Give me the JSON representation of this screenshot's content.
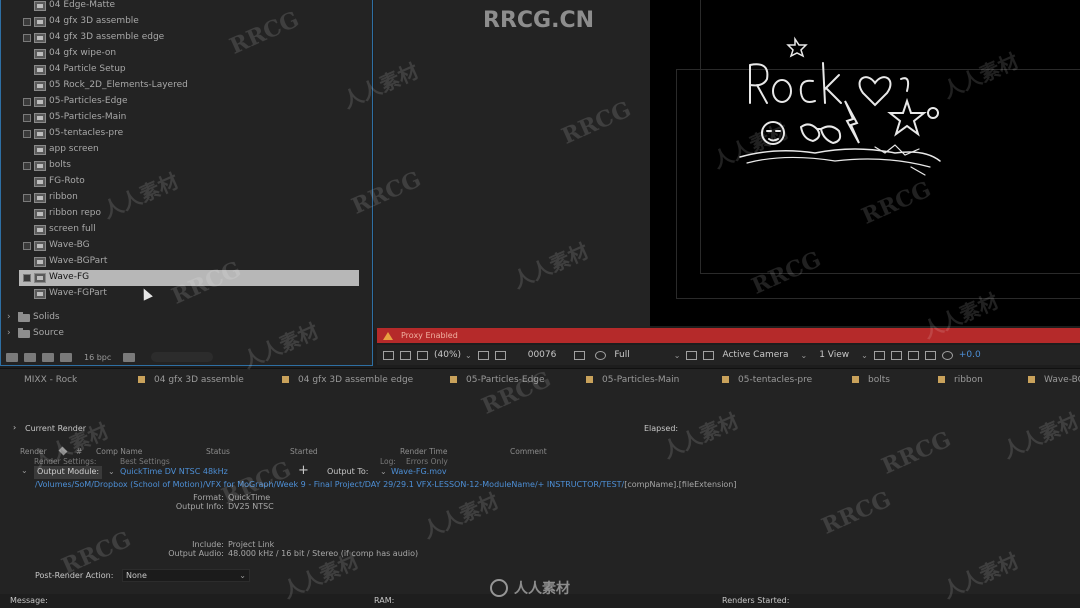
{
  "project": {
    "items": [
      {
        "label": "04 Edge-Matte",
        "checkbox": false
      },
      {
        "label": "04 gfx 3D assemble",
        "checkbox": true
      },
      {
        "label": "04 gfx 3D assemble edge",
        "checkbox": true
      },
      {
        "label": "04 gfx wipe-on",
        "checkbox": false
      },
      {
        "label": "04 Particle Setup",
        "checkbox": false
      },
      {
        "label": "05 Rock_2D_Elements-Layered",
        "checkbox": false
      },
      {
        "label": "05-Particles-Edge",
        "checkbox": true
      },
      {
        "label": "05-Particles-Main",
        "checkbox": true
      },
      {
        "label": "05-tentacles-pre",
        "checkbox": true
      },
      {
        "label": "app screen",
        "checkbox": false
      },
      {
        "label": "bolts",
        "checkbox": true
      },
      {
        "label": "FG-Roto",
        "checkbox": false
      },
      {
        "label": "ribbon",
        "checkbox": true
      },
      {
        "label": "ribbon repo",
        "checkbox": false
      },
      {
        "label": "screen full",
        "checkbox": false
      },
      {
        "label": "Wave-BG",
        "checkbox": true
      },
      {
        "label": "Wave-BGPart",
        "checkbox": false
      },
      {
        "label": "Wave-FG",
        "checkbox": true,
        "selected": true
      },
      {
        "label": "Wave-FGPart",
        "checkbox": false
      }
    ],
    "folders": [
      "Solids",
      "Source"
    ],
    "bpc": "16 bpc"
  },
  "viewer": {
    "proxy_text": "Proxy Enabled",
    "zoom": "(40%)",
    "timecode": "00076",
    "resolution": "Full",
    "camera": "Active Camera",
    "views": "1 View",
    "exposure": "+0.0"
  },
  "render_tabs": [
    "MIXX - Rock",
    "04 gfx 3D assemble",
    "04 gfx 3D assemble edge",
    "05-Particles-Edge",
    "05-Particles-Main",
    "05-tentacles-pre",
    "bolts",
    "ribbon",
    "Wave-BG"
  ],
  "render_queue": {
    "current_render": "Current Render",
    "elapsed": "Elapsed:",
    "columns": [
      "Render",
      "#",
      "Comp Name",
      "Status",
      "Started",
      "Render Time",
      "Comment"
    ],
    "render_settings_label": "Render Settings:",
    "render_settings_value": "Best Settings",
    "log_label": "Log:",
    "log_value": "Errors Only",
    "output_module_label": "Output Module:",
    "output_module_value": "QuickTime DV NTSC 48kHz",
    "output_to_label": "Output To:",
    "output_to_value": "Wave-FG.mov",
    "path": "/Volumes/SoM/Dropbox (School of Motion)/VFX for MoGraph/Week 9 - Final Project/DAY 29/29.1 VFX-LESSON-12-ModuleName/+ INSTRUCTOR/TEST/",
    "path_tail": "[compName].[fileExtension]",
    "format_label": "Format:",
    "format_value": "QuickTime",
    "output_info_label": "Output Info:",
    "output_info_value": "DV25 NTSC",
    "include_label": "Include:",
    "include_value": "Project Link",
    "output_audio_label": "Output Audio:",
    "output_audio_value": "48.000 kHz / 16 bit / Stereo (if comp has audio)",
    "post_render_label": "Post-Render Action:",
    "post_render_value": "None"
  },
  "status_bar": {
    "message": "Message:",
    "ram": "RAM:",
    "renders_started": "Renders Started:"
  },
  "watermarks": {
    "top": "RRCG.CN",
    "bottom": "人人素材",
    "repeat_a": "RRCG",
    "repeat_b": "人人素材"
  },
  "colors": {
    "accent_blue": "#4d8fd6",
    "proxy_red": "#b52a2a",
    "comp_tab_swatch": "#c9a25b"
  }
}
